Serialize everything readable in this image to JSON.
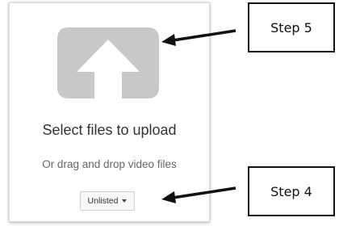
{
  "upload": {
    "title": "Select files to upload",
    "subtitle": "Or drag and drop video files",
    "icon": "upload-arrow-icon",
    "icon_color": "#c8c8c8"
  },
  "privacy": {
    "selected": "Unlisted"
  },
  "annotations": {
    "step5_label": "Step 5",
    "step4_label": "Step 4"
  }
}
